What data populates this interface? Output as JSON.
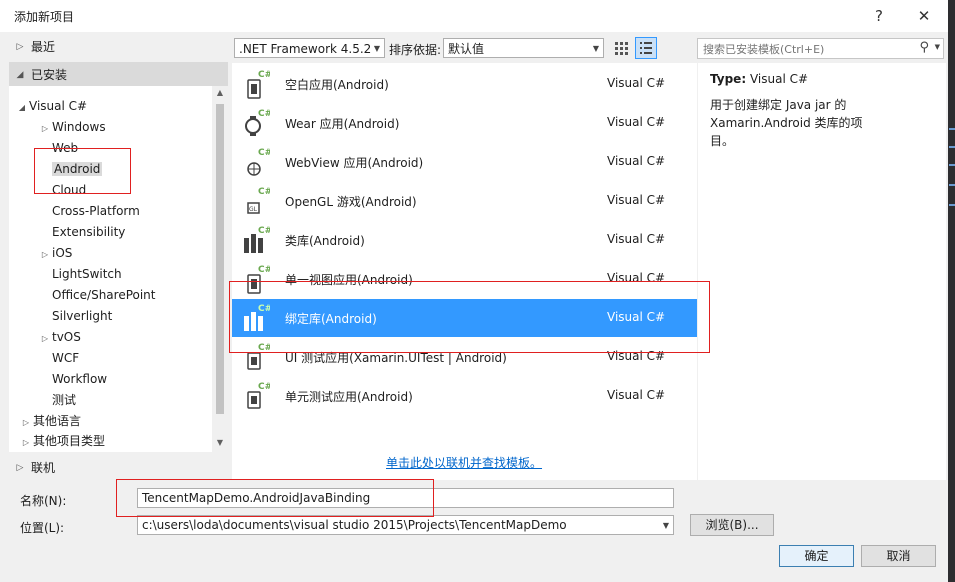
{
  "window": {
    "title": "添加新项目",
    "help_glyph": "?",
    "close_glyph": "✕"
  },
  "left": {
    "recent": "最近",
    "installed": "已安装",
    "online": "联机",
    "tree": {
      "visual_csharp": "Visual C#",
      "windows": "Windows",
      "web": "Web",
      "android": "Android",
      "cloud": "Cloud",
      "cross_platform": "Cross-Platform",
      "extensibility": "Extensibility",
      "ios": "iOS",
      "lightswitch": "LightSwitch",
      "office_sharepoint": "Office/SharePoint",
      "silverlight": "Silverlight",
      "tvos": "tvOS",
      "wcf": "WCF",
      "workflow": "Workflow",
      "test": "测试",
      "other_languages": "其他语言",
      "other_project_types": "其他项目类型"
    }
  },
  "toolbar": {
    "framework": ".NET Framework 4.5.2",
    "sort_label": "排序依据:",
    "sort_value": "默认值",
    "search_placeholder": "搜索已安装模板(Ctrl+E)"
  },
  "templates": [
    {
      "name": "空白应用(Android)",
      "lang": "Visual C#"
    },
    {
      "name": "Wear 应用(Android)",
      "lang": "Visual C#"
    },
    {
      "name": "WebView 应用(Android)",
      "lang": "Visual C#"
    },
    {
      "name": "OpenGL 游戏(Android)",
      "lang": "Visual C#"
    },
    {
      "name": "类库(Android)",
      "lang": "Visual C#"
    },
    {
      "name": "单一视图应用(Android)",
      "lang": "Visual C#"
    },
    {
      "name": "绑定库(Android)",
      "lang": "Visual C#"
    },
    {
      "name": "UI 测试应用(Xamarin.UITest | Android)",
      "lang": "Visual C#"
    },
    {
      "name": "单元测试应用(Android)",
      "lang": "Visual C#"
    }
  ],
  "online_link": "单击此处以联机并查找模板。",
  "info": {
    "type_label": "Type:",
    "type_value": "Visual C#",
    "description": "用于创建绑定 Java jar 的 Xamarin.Android 类库的项目。"
  },
  "form": {
    "name_label": "名称(N):",
    "name_value": "TencentMapDemo.AndroidJavaBinding",
    "location_label": "位置(L):",
    "location_value": "c:\\users\\loda\\documents\\visual studio 2015\\Projects\\TencentMapDemo",
    "browse": "浏览(B)...",
    "ok": "确定",
    "cancel": "取消"
  },
  "colors": {
    "selection": "#3399ff",
    "highlight_box": "#e02020",
    "link": "#0066cc"
  }
}
